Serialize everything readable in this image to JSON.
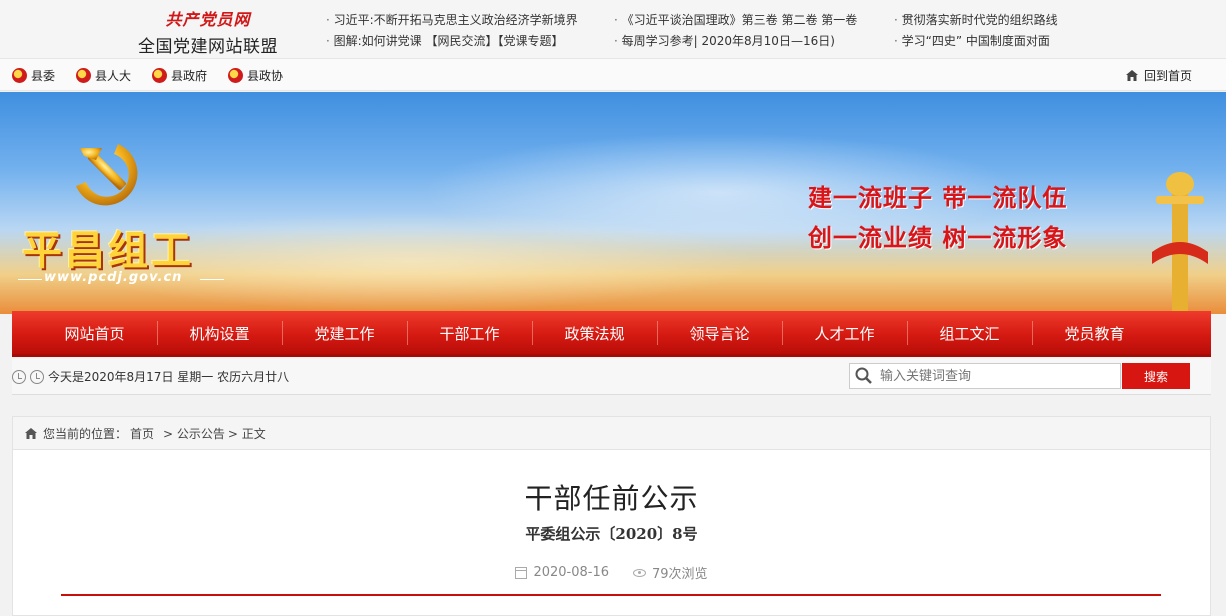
{
  "alliance": {
    "logo_text": "共产党员网",
    "name": "全国党建网站联盟",
    "links_col1": [
      "习近平:不断开拓马克思主义政治经济学新境界",
      "图解:如何讲党课 【网民交流】【党课专题】"
    ],
    "links_col2": [
      "《习近平谈治国理政》第三卷 第二卷 第一卷",
      "每周学习参考| 2020年8月10日—16日)"
    ],
    "links_col3": [
      "贯彻落实新时代党的组织路线",
      "学习“四史” 中国制度面对面"
    ]
  },
  "govbar": {
    "items": [
      "县委",
      "县人大",
      "县政府",
      "县政协"
    ],
    "home": "回到首页"
  },
  "banner": {
    "site_title": "平昌组工",
    "site_url": "www.pcdj.gov.cn",
    "slogan_line1": "建一流班子  带一流队伍",
    "slogan_line2": "创一流业绩  树一流形象"
  },
  "nav": {
    "items": [
      "网站首页",
      "机构设置",
      "党建工作",
      "干部工作",
      "政策法规",
      "领导言论",
      "人才工作",
      "组工文汇",
      "党员教育"
    ]
  },
  "infobar": {
    "date_text": "今天是2020年8月17日 星期一 农历六月廿八",
    "search_placeholder": "输入关键词查询",
    "search_button": "搜索"
  },
  "breadcrumb": {
    "prefix": "您当前的位置：",
    "items": [
      "首页",
      "> 公示公告",
      "> 正文"
    ]
  },
  "article": {
    "title": "干部任前公示",
    "subtitle": "平委组公示〔2020〕8号",
    "date": "2020-08-16",
    "views": "79次浏览"
  },
  "colors": {
    "accent_red": "#d51a12",
    "slogan_red": "#d8161a",
    "title_gold": "#ffd33a"
  }
}
